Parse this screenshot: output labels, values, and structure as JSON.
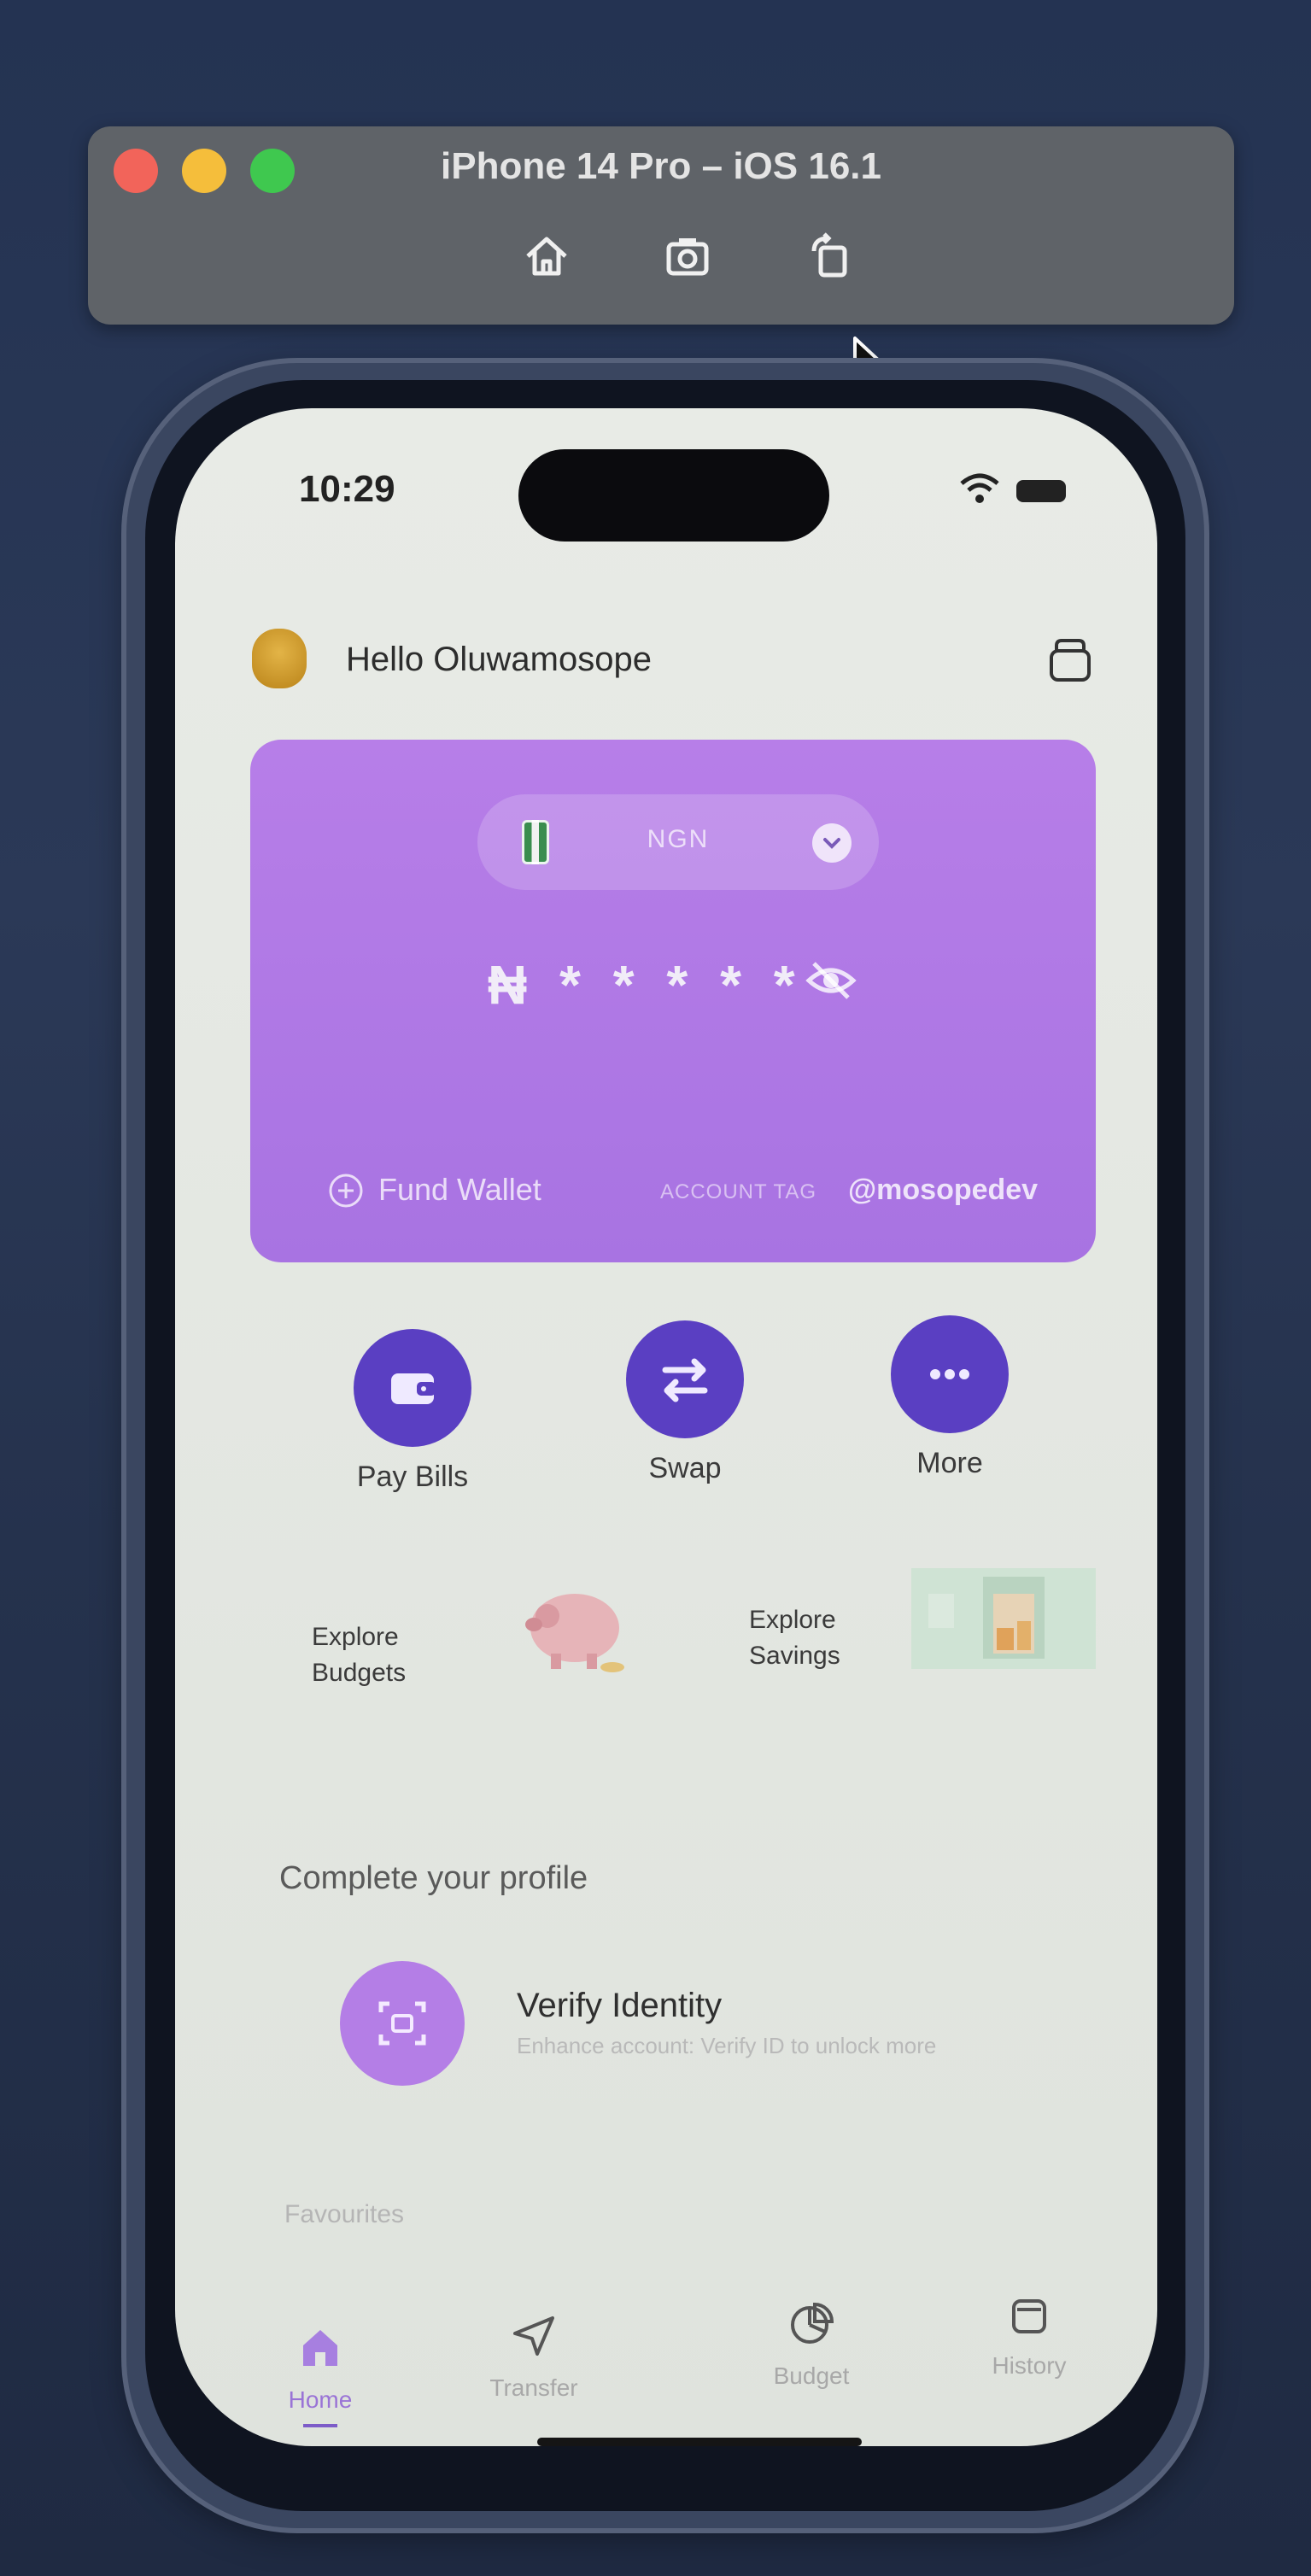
{
  "simulator": {
    "title": "iPhone 14 Pro – iOS 16.1",
    "toolbar_icons": [
      "home-icon",
      "screenshot-icon",
      "rotate-icon"
    ]
  },
  "status_bar": {
    "time": "10:29"
  },
  "header": {
    "greeting": "Hello Oluwamosope"
  },
  "wallet_card": {
    "currency": "NGN",
    "balance_masked": "₦ * * * * *",
    "fund_label": "Fund Wallet",
    "account_tag_label": "ACCOUNT TAG",
    "account_tag": "@mosopedev"
  },
  "quick_actions": [
    {
      "label": "Pay Bills",
      "icon": "wallet-icon"
    },
    {
      "label": "Swap",
      "icon": "swap-arrows-icon"
    },
    {
      "label": "More",
      "icon": "more-dots-icon"
    }
  ],
  "explore": {
    "budgets_line1": "Explore",
    "budgets_line2": "Budgets",
    "savings_line1": "Explore",
    "savings_line2": "Savings"
  },
  "profile": {
    "section_title": "Complete your profile",
    "verify_title": "Verify Identity",
    "verify_subtitle": "Enhance account: Verify ID to unlock more"
  },
  "favourites_title": "Favourites",
  "tabs": [
    {
      "label": "Home",
      "icon": "home-icon",
      "active": true
    },
    {
      "label": "Transfer",
      "icon": "send-icon",
      "active": false
    },
    {
      "label": "Budget",
      "icon": "pie-chart-icon",
      "active": false
    },
    {
      "label": "History",
      "icon": "history-icon",
      "active": false
    }
  ],
  "colors": {
    "card": "#b077e6",
    "action_circle": "#5a3fc2",
    "verify_circle": "#b47ee6",
    "active_tab": "#9a74d6"
  }
}
